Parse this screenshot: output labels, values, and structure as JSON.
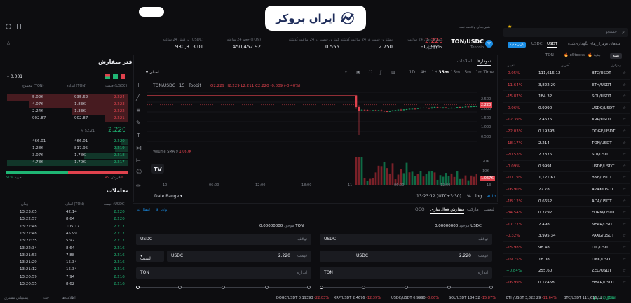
{
  "logo": {
    "text": "ایران بروکر"
  },
  "ticker": {
    "pair": "TON/USDC",
    "exchange": "Toncoin",
    "price": "2.220",
    "price_usd": "≈$2.21",
    "stats": [
      {
        "label": "تغییرات طی 24 ساعت",
        "value": "-17.96%",
        "tone": "red"
      },
      {
        "label": "بیشترین قیمت در 24 ساعت گذشته",
        "value": "2.750",
        "tone": "normal"
      },
      {
        "label": "کمترین قیمت در 24 ساعت گذشته",
        "value": "0.555",
        "tone": "normal"
      },
      {
        "label": "حجم 24 ساعته (TON)",
        "value": "450,452.92",
        "tone": "normal"
      },
      {
        "label": "تراکنش 24 ساعته (USDC)",
        "value": "930,313.01",
        "tone": "normal"
      }
    ],
    "notice": "شیرجه‌ای واقعت نیت"
  },
  "orderbook": {
    "title": "دفتر سفارش",
    "precision": "0.001",
    "headers": [
      "قیمت (USDC)",
      "اندازه (TON)",
      "مجموع (TON)"
    ],
    "asks": [
      [
        "2.224",
        "935.62",
        "5.02K"
      ],
      [
        "2.223",
        "1.83K",
        "4.07K"
      ],
      [
        "2.222",
        "1.33K",
        "2.24K"
      ],
      [
        "2.221",
        "902.87",
        "902.87"
      ]
    ],
    "mid_price": "2.220",
    "mid_usd": "≈ $2.21",
    "bids": [
      [
        "2.220",
        "466.01",
        "466.01"
      ],
      [
        "2.219",
        "817.95",
        "1.28K"
      ],
      [
        "2.218",
        "1.78K",
        "3.07K"
      ],
      [
        "2.217",
        "1.70K",
        "4.78K"
      ]
    ],
    "buy_label": "خرید",
    "buy_pct": "51%",
    "sell_label": "فروش",
    "sell_pct": "49%"
  },
  "trades": {
    "title": "معاملات",
    "headers": [
      "قیمت (USDC)",
      "اندازه (TON)",
      "زمان"
    ],
    "rows": [
      [
        "2.220",
        "42.14",
        "13:23:05"
      ],
      [
        "2.220",
        "8.64",
        "13:22:57"
      ],
      [
        "2.217",
        "105.17",
        "13:22:48"
      ],
      [
        "2.217",
        "45.99",
        "13:22:48"
      ],
      [
        "2.217",
        "5.92",
        "13:22:35"
      ],
      [
        "2.216",
        "8.64",
        "13:22:34"
      ],
      [
        "2.216",
        "7.88",
        "13:21:53"
      ],
      [
        "2.216",
        "15.34",
        "13:21:29"
      ],
      [
        "2.216",
        "15.34",
        "13:21:12"
      ],
      [
        "2.216",
        "7.94",
        "13:20:59"
      ],
      [
        "2.216",
        "8.62",
        "13:20:55"
      ]
    ]
  },
  "chart": {
    "tabs": [
      "نمودارها",
      "اطلاعات"
    ],
    "intervals": [
      "Time",
      "1m",
      "5m",
      "15m",
      "35m",
      "1H",
      "4H",
      "1D"
    ],
    "selected_interval": "35m",
    "style_label": "اصلی",
    "legend": "TON/USDC · 15 · Toobit",
    "ohlc": "O2.229 H2.229 L2.211 C2.220 -0.009 (-0.40%)",
    "volume_label": "Volume SMA 9",
    "volume_value": "1.067K",
    "price_ticks": [
      "2.500",
      "2.000",
      "1.500",
      "1.000",
      "0.500"
    ],
    "current_price": "2.220",
    "vol_ticks": [
      "20K",
      "10K"
    ],
    "time_ticks": [
      "10",
      "06:00",
      "12:00",
      "18:00",
      "11",
      "06:00",
      "12:00",
      "13"
    ],
    "date_range": "Date Range",
    "clock": "13:23:12 (UTC+3:30)",
    "scale_pct": "%",
    "scale_log": "log",
    "scale_auto": "auto"
  },
  "chart_data": {
    "type": "line",
    "title": "",
    "xlabel": "",
    "ylabel": "",
    "ylim": [
      0,
      3
    ],
    "note": "candlestick price series TON/USDC",
    "x": [
      0,
      1,
      2,
      3,
      4,
      5,
      6,
      7,
      8,
      9,
      10,
      11
    ],
    "series": [
      {
        "values": [
          2.7,
          2.72,
          2.71,
          2.7,
          2.0,
          0.6,
          1.9,
          2.05,
          2.15,
          2.2,
          2.23,
          2.22
        ]
      }
    ]
  },
  "orders": {
    "tabs": [
      "لیمیت",
      "مارکت",
      "سفارش فعال‌سازی",
      "OCO"
    ],
    "options_label": "انتقال",
    "fee_label": "واریز",
    "buy": {
      "available_label": "موجود",
      "available": "0.00000000 USDC",
      "stop_label": "توقف",
      "stop_unit": "USDC",
      "price_label": "قیمت",
      "price_value": "2.220",
      "price_unit": "USDC",
      "amount_label": "اندازه",
      "amount_unit": "TON"
    },
    "sell": {
      "available_label": "موجود",
      "available": "0.00000000 TON",
      "stop_label": "توقف",
      "stop_unit": "USDC",
      "price_label": "قیمت",
      "price_value": "2.220",
      "price_unit": "USDC",
      "type_label": "لیمیت",
      "amount_label": "اندازه",
      "amount_unit": "TON"
    }
  },
  "markets": {
    "search_placeholder": "جستجو",
    "tabs": [
      "مندهای من",
      "رمزارزهای نگهداری‌شده",
      "USDT",
      "USDC",
      "TON"
    ],
    "promo": "بازار جدید",
    "subtabs": [
      "همه",
      "جدید",
      "xStocks"
    ],
    "headers": [
      "رمزارز",
      "آخرین",
      "تغییر"
    ],
    "rows": [
      [
        "BTC/USDT",
        "111,616.12",
        "-0.05%"
      ],
      [
        "ETH/USDT",
        "3,822.29",
        "-11.64%"
      ],
      [
        "SOL/USDT",
        "184.32",
        "-15.87%"
      ],
      [
        "USDC/USDT",
        "0.9990",
        "-0.06%"
      ],
      [
        "XRP/USDT",
        "2.4676",
        "-12.39%"
      ],
      [
        "DOGE/USDT",
        "0.19393",
        "-22.03%"
      ],
      [
        "TON/USDT",
        "2.214",
        "-18.17%"
      ],
      [
        "SUI/USDT",
        "2.7376",
        "-20.53%"
      ],
      [
        "USDE/USDT",
        "0.9991",
        "-0.09%"
      ],
      [
        "BNB/USDT",
        "1,121.61",
        "-10.19%"
      ],
      [
        "AVAX/USDT",
        "22.78",
        "-16.90%"
      ],
      [
        "ADA/USDT",
        "0.6652",
        "-18.12%"
      ],
      [
        "FORM/USDT",
        "0.7792",
        "-34.54%"
      ],
      [
        "NEAR/USDT",
        "2.498",
        "-17.77%"
      ],
      [
        "PAXG/USDT",
        "3,995.34",
        "-0.32%"
      ],
      [
        "LTC/USDT",
        "98.48",
        "-15.98%"
      ],
      [
        "LINK/USDT",
        "18.08",
        "-19.75%"
      ],
      [
        "ZEC/USDT",
        "255.60",
        "+0.84%"
      ],
      [
        "HBAR/USDT",
        "0.17458",
        "-16.99%"
      ]
    ]
  },
  "footer": {
    "connection": "اتصال پایدار",
    "ticker_items": [
      [
        "BTC/USDT",
        "111,616.12",
        "0.05%"
      ],
      [
        "ETH/USDT",
        "3,822.29",
        "-11.64%"
      ],
      [
        "SOL/USDT",
        "184.32",
        "-15.87%"
      ],
      [
        "USDC/USDT",
        "0.9990",
        "-0.06%"
      ],
      [
        "XRP/USDT",
        "2.4676",
        "-12.39%"
      ],
      [
        "DOGE/USDT",
        "0.19393",
        "-22.03%"
      ]
    ],
    "left_items": [
      "پشتیبانی مشتری",
      "چت",
      "اطلاعیه‌ها"
    ]
  },
  "colors": {
    "up": "#1fb574",
    "down": "#e0424d",
    "accent": "#f0b90b",
    "bg": "#0d0d10"
  }
}
